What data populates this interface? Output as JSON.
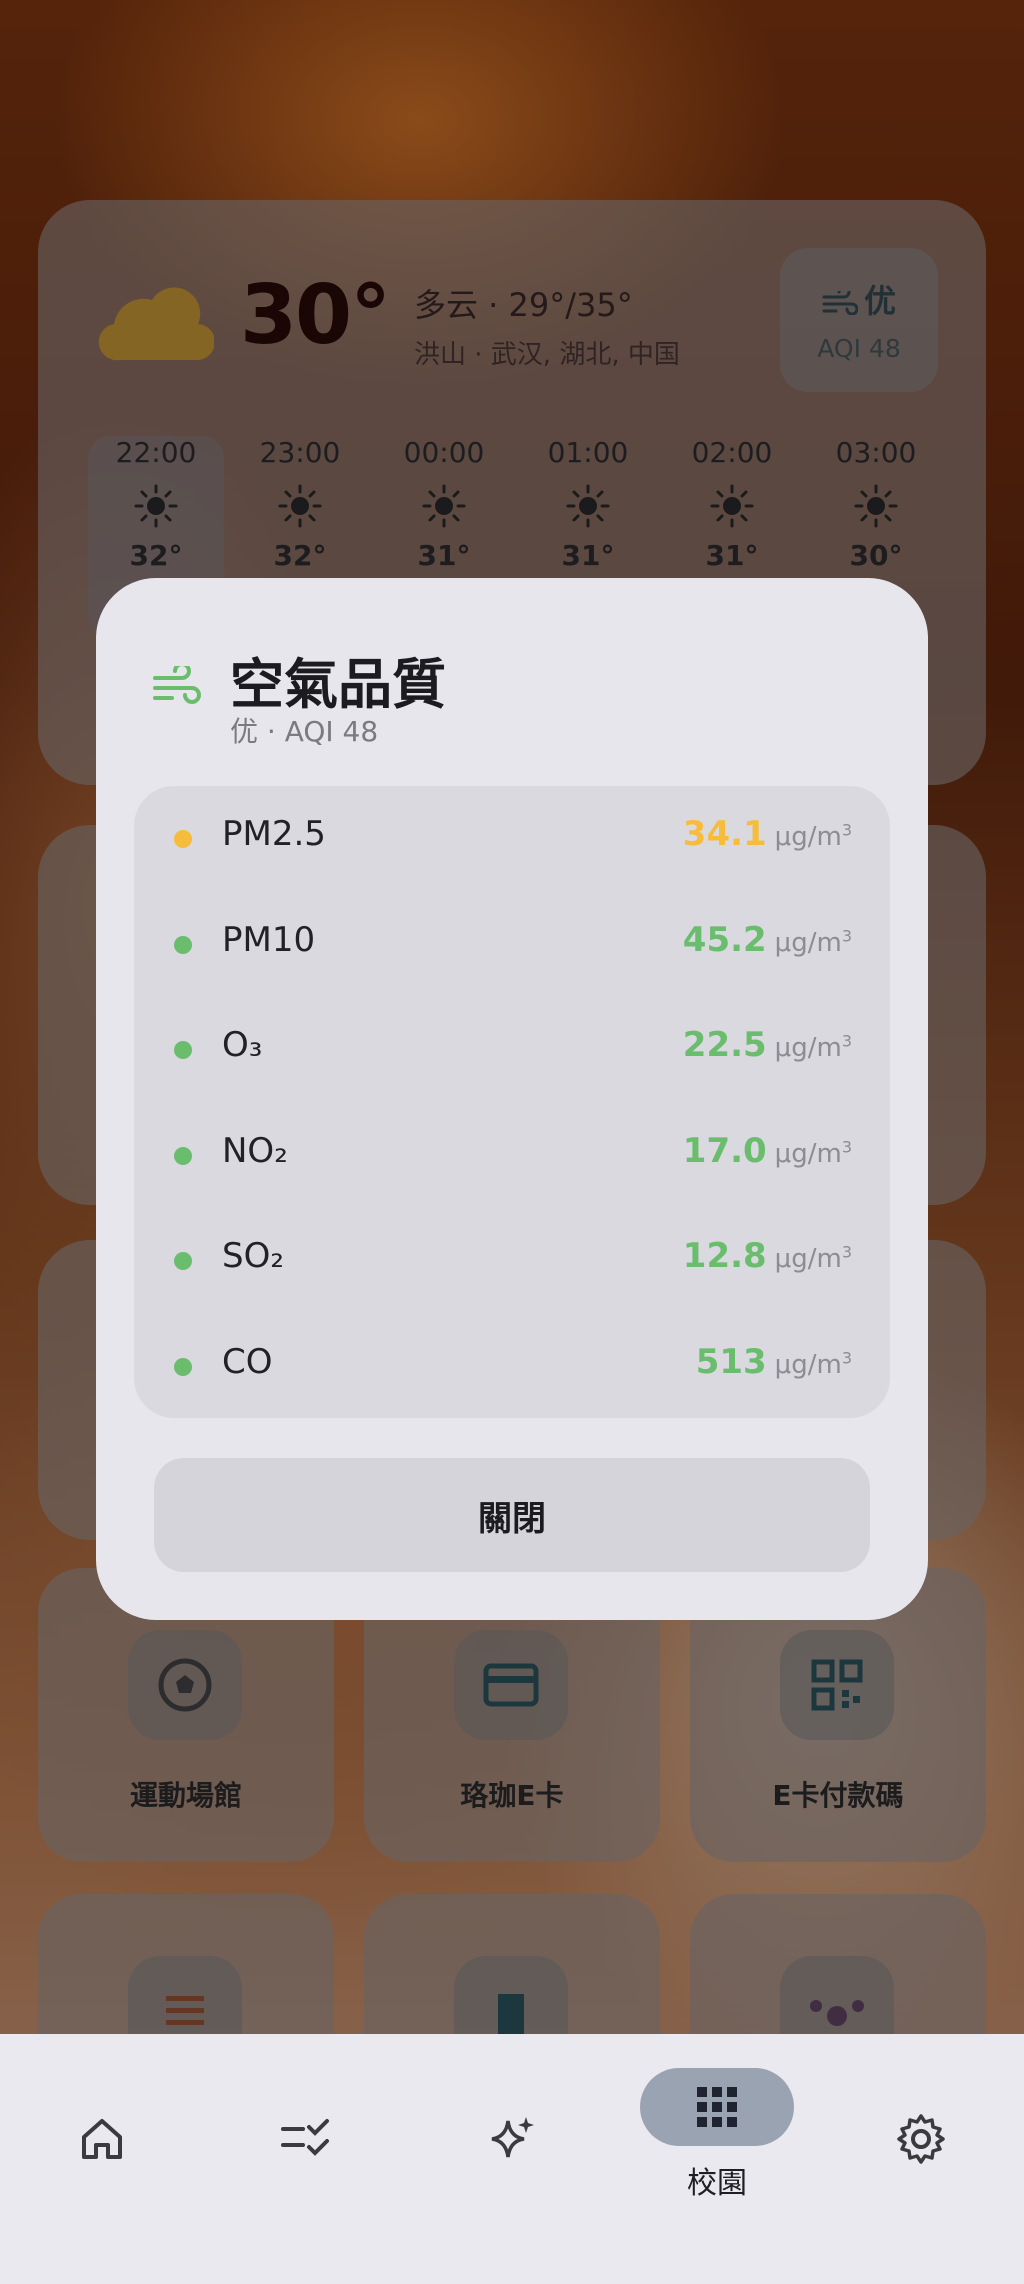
{
  "weather": {
    "temperature": "30°",
    "description": "多云 · 29°/35°",
    "location": "洪山 · 武汉, 湖北, 中国",
    "aqi_level": "优",
    "aqi_value": "AQI 48",
    "hourly": [
      {
        "time": "22:00",
        "temp": "32°"
      },
      {
        "time": "23:00",
        "temp": "32°"
      },
      {
        "time": "00:00",
        "temp": "31°"
      },
      {
        "time": "01:00",
        "temp": "31°"
      },
      {
        "time": "02:00",
        "temp": "31°"
      },
      {
        "time": "03:00",
        "temp": "30°"
      }
    ]
  },
  "tiles": [
    {
      "label": "運動場館",
      "icon": "soccer-ball-icon"
    },
    {
      "label": "珞珈E卡",
      "icon": "card-icon"
    },
    {
      "label": "E卡付款碼",
      "icon": "qr-code-icon"
    },
    {
      "label": "",
      "icon": "checklist-icon"
    },
    {
      "label": "",
      "icon": "door-icon"
    },
    {
      "label": "",
      "icon": "network-icon"
    }
  ],
  "modal": {
    "title": "空氣品質",
    "subtitle": "优 · AQI 48",
    "pollutants": [
      {
        "name": "PM2.5",
        "value": "34.1",
        "unit": "μg/m",
        "color": "#f6bd3c"
      },
      {
        "name": "PM10",
        "value": "45.2",
        "unit": "μg/m",
        "color": "#6bbd6e"
      },
      {
        "name": "O₃",
        "value": "22.5",
        "unit": "μg/m",
        "color": "#6bbd6e"
      },
      {
        "name": "NO₂",
        "value": "17.0",
        "unit": "μg/m",
        "color": "#6bbd6e"
      },
      {
        "name": "SO₂",
        "value": "12.8",
        "unit": "μg/m",
        "color": "#6bbd6e"
      },
      {
        "name": "CO",
        "value": "513",
        "unit": "μg/m",
        "color": "#6bbd6e"
      }
    ],
    "unit_exponent": "3",
    "close_label": "關閉"
  },
  "nav": {
    "items": [
      "home-icon",
      "tasks-icon",
      "sparkle-icon",
      "apps-grid-icon",
      "gear-icon"
    ],
    "active_label": "校園"
  }
}
